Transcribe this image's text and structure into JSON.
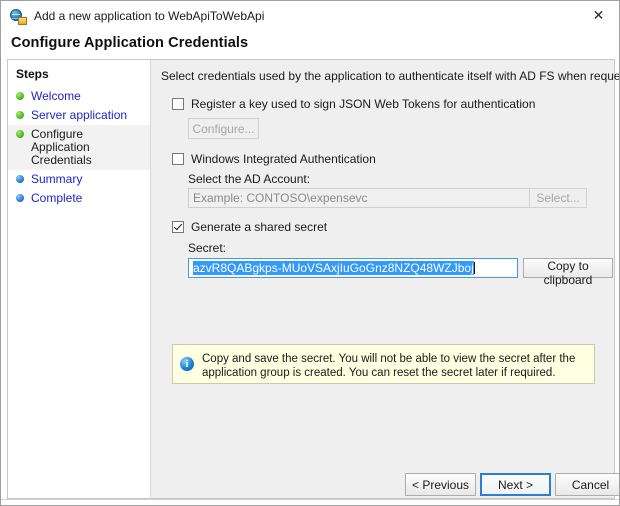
{
  "window": {
    "title": "Add a new application to WebApiToWebApi",
    "app_icon": "adfs-application-icon",
    "close_icon": "close-icon",
    "heading": "Configure Application Credentials"
  },
  "sidebar": {
    "title": "Steps",
    "items": [
      {
        "label": "Welcome",
        "state": "done",
        "current": false
      },
      {
        "label": "Server application",
        "state": "done",
        "current": false
      },
      {
        "label": "Configure Application\nCredentials",
        "state": "done",
        "current": true
      },
      {
        "label": "Summary",
        "state": "todo",
        "current": false
      },
      {
        "label": "Complete",
        "state": "todo",
        "current": false
      }
    ]
  },
  "content": {
    "intro": "Select credentials used by the application to authenticate itself with AD FS when requesting access tokens.",
    "jwt": {
      "checkbox_label": "Register a key used to sign JSON Web Tokens for authentication",
      "checked": false,
      "configure_button": "Configure..."
    },
    "wia": {
      "checkbox_label": "Windows Integrated Authentication",
      "checked": false,
      "ad_account_label": "Select the AD Account:",
      "ad_account_placeholder": "Example: CONTOSO\\expensevc",
      "ad_account_value": "",
      "select_button": "Select..."
    },
    "shared_secret": {
      "checkbox_label": "Generate a shared secret",
      "checked": true,
      "secret_label": "Secret:",
      "secret_value": "azvR8QABgkps-MUoVSAxjIuGoGnz8NZQ48WZJboj",
      "copy_button": "Copy to clipboard"
    },
    "info": {
      "icon": "info-icon",
      "text": "Copy and save the secret.  You will not be able to view the secret after the application group is created.  You can reset the secret later if required."
    }
  },
  "footer": {
    "previous": "< Previous",
    "next": "Next >",
    "cancel": "Cancel"
  },
  "colors": {
    "step_done": "#4fbd27",
    "step_todo": "#2a7fd4",
    "link": "#2323c8",
    "selection": "#3399ff",
    "info_bg": "#ffffe1",
    "accent": "#2a7fd4"
  }
}
